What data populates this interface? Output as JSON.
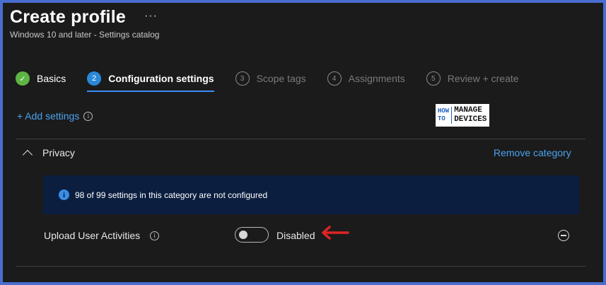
{
  "header": {
    "title": "Create profile",
    "more_glyph": "···",
    "subtitle": "Windows 10 and later - Settings catalog"
  },
  "steps": [
    {
      "number": "✓",
      "label": "Basics",
      "state": "done"
    },
    {
      "number": "2",
      "label": "Configuration settings",
      "state": "active"
    },
    {
      "number": "3",
      "label": "Scope tags",
      "state": "pending"
    },
    {
      "number": "4",
      "label": "Assignments",
      "state": "pending"
    },
    {
      "number": "5",
      "label": "Review + create",
      "state": "pending"
    }
  ],
  "add_settings": {
    "label": "+ Add settings",
    "info_glyph": "i"
  },
  "logo": {
    "how": "HOW",
    "to": "TO",
    "manage": "MANAGE",
    "devices": "DEVICES"
  },
  "category": {
    "label": "Privacy",
    "remove_label": "Remove category",
    "banner": {
      "icon_glyph": "i",
      "text": "98 of 99 settings in this category are not configured"
    }
  },
  "setting": {
    "label": "Upload User Activities",
    "info_glyph": "i",
    "toggle_on": false,
    "state_text": "Disabled"
  },
  "colors": {
    "accent": "#3e8ef7",
    "link": "#4aa3f0",
    "done": "#5fb544",
    "banner_bg": "#0b1e3f",
    "arrow": "#e02424",
    "page_bg": "#1b1b1b",
    "outer_frame": "#4a6ecf"
  },
  "icons": {
    "more": "more-ellipsis-icon",
    "info": "info-icon",
    "collapse": "chevron-up-icon",
    "remove": "remove-circle-icon",
    "annotation": "red-arrow-icon"
  }
}
